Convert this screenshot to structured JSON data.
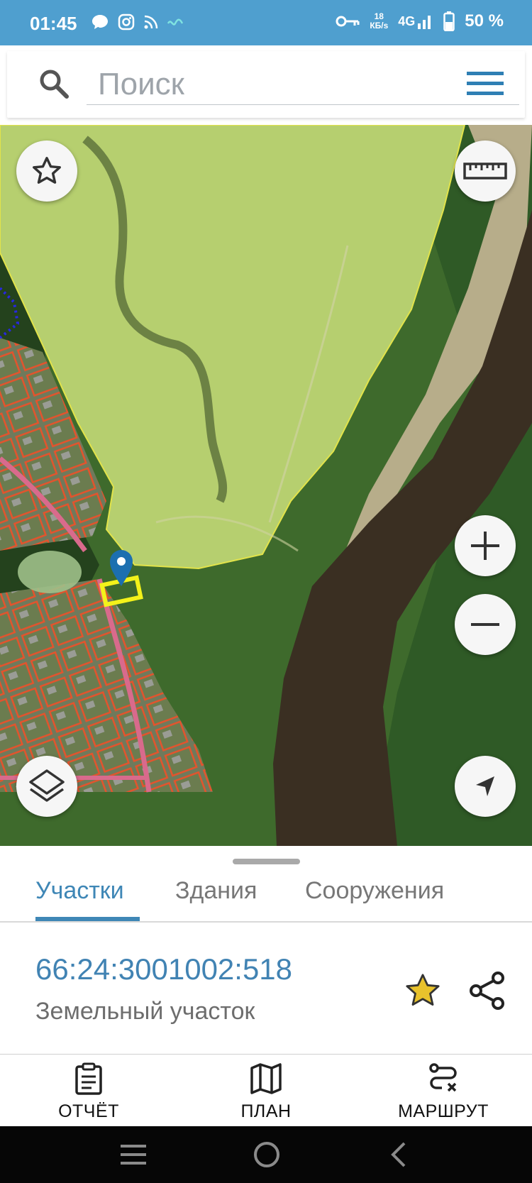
{
  "status_bar": {
    "time": "01:45",
    "notification_icons": [
      "chat-icon",
      "instagram-icon",
      "rss-icon",
      "wave-icon"
    ],
    "key_icon": "key-icon",
    "speed_value": "18",
    "speed_unit": "КБ/s",
    "network": "4G",
    "battery": "50 %"
  },
  "search": {
    "placeholder": "Поиск",
    "icon": "search-icon",
    "menu_icon": "hamburger-menu-icon"
  },
  "map": {
    "buttons": [
      "favorite-star-icon",
      "ruler-icon",
      "zoom-in-icon",
      "zoom-out-icon",
      "layers-icon",
      "locate-icon"
    ],
    "colors": {
      "river": "#3a2f22",
      "parcel_outline": "#e2e34a",
      "parcel_fill": "#b6cf6f",
      "village_boundaries": "#e5532c",
      "selected_parcel": "#f3f21a",
      "marker": "#1c6fb0"
    }
  },
  "tabs": [
    {
      "label": "Участки",
      "active": true
    },
    {
      "label": "Здания",
      "active": false
    },
    {
      "label": "Сооружения",
      "active": false
    }
  ],
  "parcel": {
    "number": "66:24:3001002:518",
    "type": "Земельный участок",
    "favorite": true,
    "star_color": "#e8c22c"
  },
  "bottom_nav": [
    {
      "label": "ОТЧЁТ",
      "icon": "clipboard-report-icon"
    },
    {
      "label": "ПЛАН",
      "icon": "map-plan-icon"
    },
    {
      "label": "МАРШРУТ",
      "icon": "route-icon"
    }
  ],
  "system_nav": [
    "recents-icon",
    "home-icon",
    "back-icon"
  ],
  "theme": {
    "status_bar_bg": "#4f9fcf",
    "accent": "#3f87b6"
  }
}
